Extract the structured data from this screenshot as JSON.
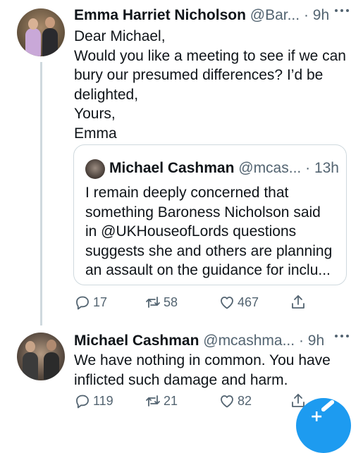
{
  "tweets": [
    {
      "name": "Emma Harriet Nicholson",
      "handle": "@Bar...",
      "separator": "·",
      "time": "9h",
      "lines": [
        "Dear Michael,",
        "Would you like a meeting to see if we can",
        "bury our presumed differences? I’d be",
        "delighted,",
        "Yours,",
        "Emma"
      ],
      "quote": {
        "name": "Michael Cashman",
        "handle": "@mcas...",
        "separator": "·",
        "time": "13h",
        "lines": [
          "I remain deeply concerned that",
          "something Baroness Nicholson said",
          "in @UKHouseofLords questions",
          "suggests she and others are planning",
          "an assault on the guidance for inclu..."
        ]
      },
      "stats": {
        "replies": "17",
        "retweets": "58",
        "likes": "467"
      }
    },
    {
      "name": "Michael Cashman",
      "handle": "@mcashma...",
      "separator": "·",
      "time": "9h",
      "lines": [
        "We have nothing in common. You have",
        "inflicted such damage and harm."
      ],
      "stats": {
        "replies": "119",
        "retweets": "21",
        "likes": "82"
      }
    }
  ],
  "icons": {
    "more": "more-icon",
    "reply": "reply-icon",
    "retweet": "retweet-icon",
    "like": "heart-icon",
    "share": "share-icon",
    "compose": "compose-icon"
  },
  "colors": {
    "text": "#0f1419",
    "muted": "#536471",
    "border": "#cfd9de",
    "accent": "#1d9bf0"
  }
}
